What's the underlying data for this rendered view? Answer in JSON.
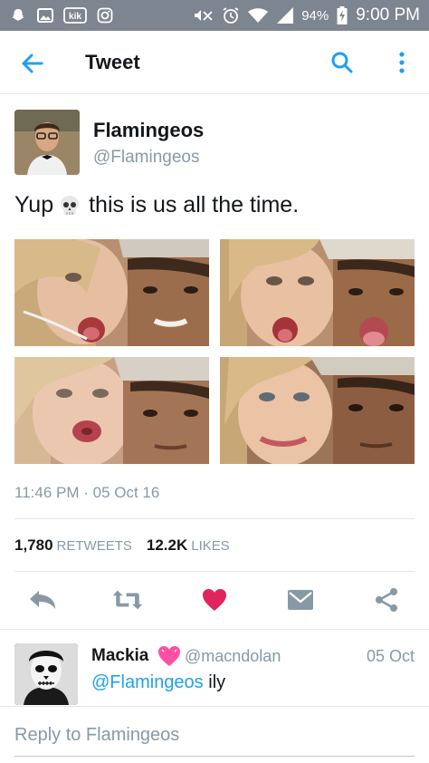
{
  "status_bar": {
    "kik_label": "kik",
    "battery": "94%",
    "time": "9:00 PM"
  },
  "header": {
    "title": "Tweet"
  },
  "tweet": {
    "name": "Flamingeos",
    "handle": "@Flamingeos",
    "text_before": "Yup",
    "text_after": "this is us all the time.",
    "timestamp": "11:46 PM · 05 Oct 16",
    "retweets_count": "1,780",
    "retweets_label": "RETWEETS",
    "likes_count": "12.2K",
    "likes_label": "LIKES"
  },
  "reply": {
    "name": "Mackia",
    "handle": "@macndolan",
    "date": "05 Oct",
    "mention": "@Flamingeos",
    "text": " ily"
  },
  "compose": {
    "placeholder": "Reply to Flamingeos"
  },
  "colors": {
    "accent": "#1da1f2",
    "like_red": "#e0245e",
    "action_gray": "#8899a6",
    "status_bar": "#7d8590"
  },
  "icons": [
    "snapchat-icon",
    "image-icon",
    "kik-icon",
    "instagram-icon",
    "mute-icon",
    "alarm-icon",
    "wifi-icon",
    "signal-icon",
    "battery-icon",
    "back-arrow-icon",
    "search-icon",
    "more-icon",
    "skull-icon",
    "reply-icon",
    "retweet-icon",
    "heart-icon",
    "dm-icon",
    "share-icon",
    "pink-heart-icon"
  ]
}
